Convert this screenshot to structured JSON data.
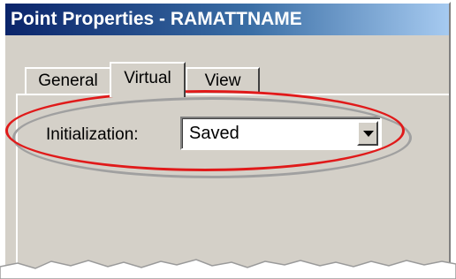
{
  "window": {
    "title": "Point Properties - RAMATTNAME"
  },
  "tabs": [
    {
      "label": "General"
    },
    {
      "label": "Virtual"
    },
    {
      "label": "View"
    }
  ],
  "initialization": {
    "label": "Initialization:",
    "value": "Saved"
  },
  "colors": {
    "highlight_ellipse": "#e01a1a",
    "dialog_bg": "#d4d0c8",
    "titlebar": "#0a246a"
  }
}
